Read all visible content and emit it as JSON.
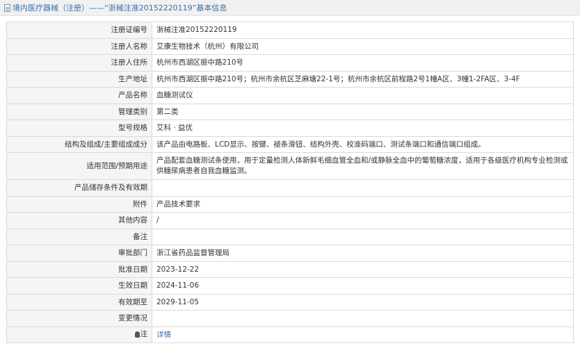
{
  "header": {
    "title": "境内医疗器械（注册）——“浙械注准20152220119”基本信息"
  },
  "rows": [
    {
      "label": "注册证编号",
      "value": "浙械注准20152220119"
    },
    {
      "label": "注册人名称",
      "value": "艾康生物技术（杭州）有限公司"
    },
    {
      "label": "注册人住所",
      "value": "杭州市西湖区振中路210号"
    },
    {
      "label": "生产地址",
      "value": "杭州市西湖区振中路210号；杭州市余杭区芝麻塘22-1号；杭州市余杭区前程路2号1幢A区、3幢1-2FA区、3-4F"
    },
    {
      "label": "产品名称",
      "value": "血糖测试仪"
    },
    {
      "label": "管理类别",
      "value": "第二类"
    },
    {
      "label": "型号规格",
      "value": "艾科 · 益优"
    },
    {
      "label": "结构及组成/主要组成成分",
      "value": "该产品由电路板、LCD显示、按键、褪条滑钮、结构外壳、校准码端口、测试条端口和通信端口组成。"
    },
    {
      "label": "适用范围/预期用途",
      "value": "产品配套血糖测试条使用，用于定量检测人体新鲜毛细血管全血和/或静脉全血中的葡萄糖浓度，适用于各级医疗机构专业检测或供糖尿病患者自我血糖监测。"
    },
    {
      "label": "产品储存条件及有效期",
      "value": ""
    },
    {
      "label": "附件",
      "value": "产品技术要求"
    },
    {
      "label": "其他内容",
      "value": "/"
    },
    {
      "label": "备注",
      "value": ""
    },
    {
      "label": "审批部门",
      "value": "浙江省药品监督管理局"
    },
    {
      "label": "批准日期",
      "value": "2023-12-22"
    },
    {
      "label": "生效日期",
      "value": "2024-11-06"
    },
    {
      "label": "有效期至",
      "value": "2029-11-05"
    },
    {
      "label": "变更情况",
      "value": ""
    }
  ],
  "note": {
    "label": "注",
    "link": "详情"
  }
}
